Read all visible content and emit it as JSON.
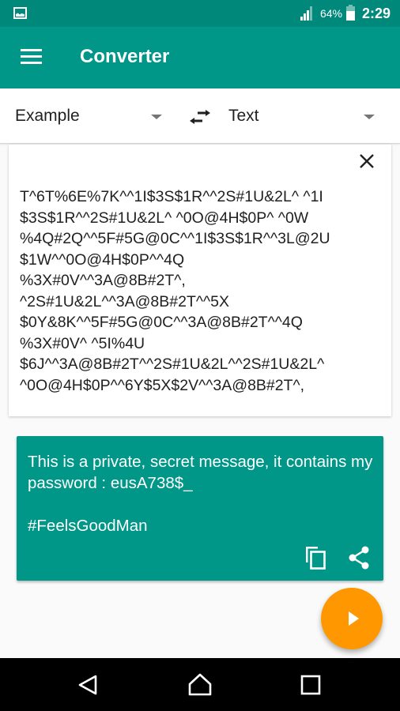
{
  "status_bar": {
    "notification_icon": "image-icon",
    "signal_icon": "cell-signal-icon",
    "battery_percent": "64%",
    "battery_level": 0.64,
    "time": "2:29"
  },
  "app_bar": {
    "menu_icon": "hamburger-menu-icon",
    "title": "Converter"
  },
  "converter": {
    "from_language": "Example",
    "to_language": "Text",
    "swap_icon": "swap-horiz-icon",
    "input_text": "T^6T%6E%7K^^1I$3S$1R^^2S#1U&2L^ ^1I$3S$1R^^2S#1U&2L^ ^0O@4H$0P^ ^0W%4Q#2Q^^5F#5G@0C^^1I$3S$1R^^3L@2U$1W^^0O@4H$0P^^4Q%3X#0V^^3A@8B#2T^, ^2S#1U&2L^^3A@8B#2T^^5X$0Y&8K^^5F#5G@0C^^3A@8B#2T^^4Q%3X#0V^ ^5I%4U$6J^^3A@8B#2T^^2S#1U&2L^^2S#1U&2L^ ^0O@4H$0P^^6Y$5X$2V^^3A@8B#2T^,",
    "input_lines": [
      "T^6T%6E%7K^^1I$3S$1R^^2S#1U&2L^ ^1I",
      "$3S$1R^^2S#1U&2L^ ^0O@4H$0P^ ^0W",
      "%4Q#2Q^^5F#5G@0C^^1I$3S$1R^^3L@2U",
      "$1W^^0O@4H$0P^^4Q",
      "%3X#0V^^3A@8B#2T^,",
      "^2S#1U&2L^^3A@8B#2T^^5X",
      "$0Y&8K^^5F#5G@0C^^3A@8B#2T^^4Q",
      "%3X#0V^ ^5I%4U",
      "$6J^^3A@8B#2T^^2S#1U&2L^^2S#1U&2L^",
      "^0O@4H$0P^^6Y$5X$2V^^3A@8B#2T^,"
    ],
    "output_text": "This is a private, secret message, it contains my password : eusA738$_\n\n#FeelsGoodMan",
    "clear_icon": "close-icon",
    "copy_icon": "content-copy-icon",
    "share_icon": "share-icon",
    "convert_icon": "play-arrow-icon"
  },
  "nav_bar": {
    "back_icon": "back-icon",
    "home_icon": "home-icon",
    "recents_icon": "recents-icon"
  },
  "colors": {
    "status_bar": "#00897b",
    "primary": "#009688",
    "accent": "#ff9800",
    "background": "#fafafa"
  }
}
